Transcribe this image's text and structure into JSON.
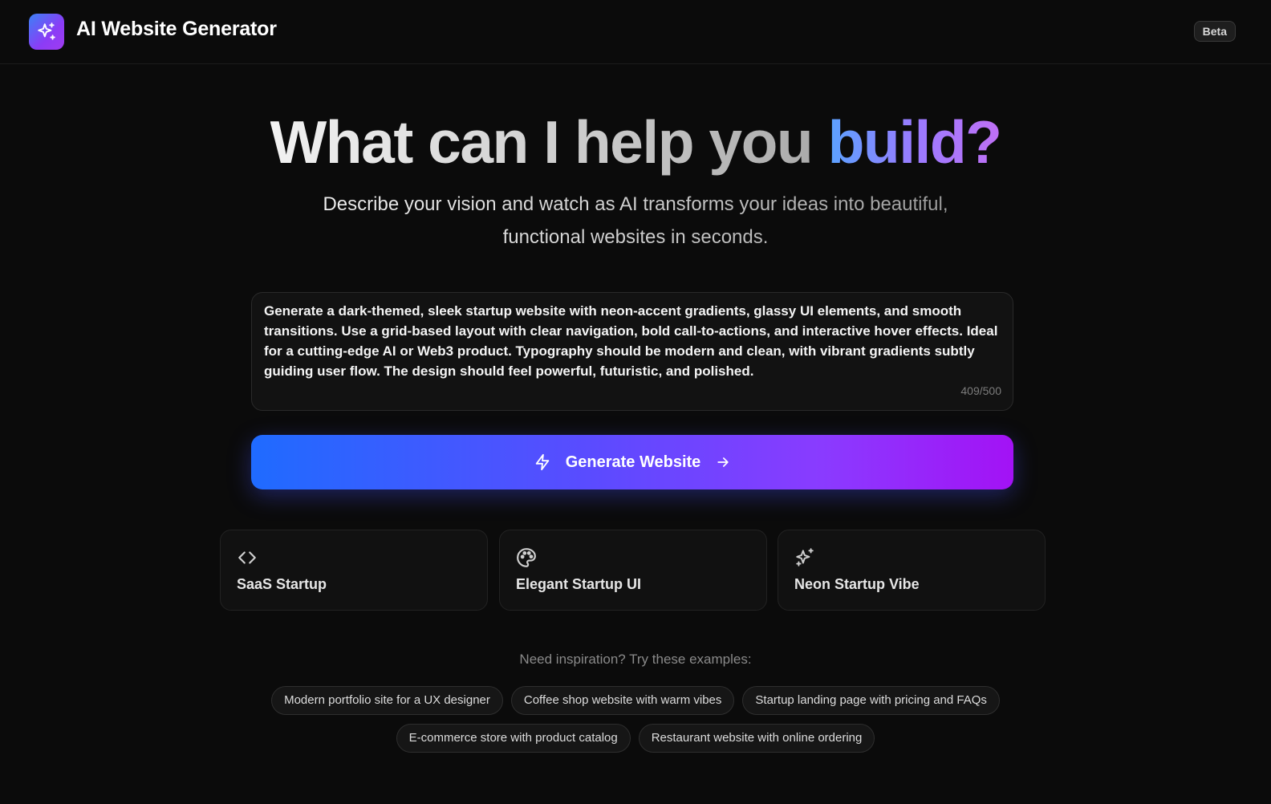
{
  "header": {
    "app_title": "AI Website Generator",
    "badge": "Beta",
    "logo_icon": "sparkles-icon"
  },
  "hero": {
    "title_plain": "What can I help you ",
    "title_accent": "build?",
    "subtitle": "Describe your vision and watch as AI transforms your ideas into beautiful, functional websites in seconds."
  },
  "prompt": {
    "value": "Generate a dark-themed, sleek startup website with neon-accent gradients, glassy UI elements, and smooth transitions. Use a grid-based layout with clear navigation, bold call-to-actions, and interactive hover effects. Ideal for a cutting-edge AI or Web3 product. Typography should be modern and clean, with vibrant gradients subtly guiding user flow. The design should feel powerful, futuristic, and polished.",
    "char_count": "409/500"
  },
  "generate_button": {
    "label": "Generate Website",
    "left_icon": "lightning-icon",
    "right_icon": "arrow-right-icon"
  },
  "templates": [
    {
      "label": "SaaS Startup",
      "icon": "code-icon"
    },
    {
      "label": "Elegant Startup UI",
      "icon": "palette-icon"
    },
    {
      "label": "Neon Startup Vibe",
      "icon": "sparkles-icon"
    }
  ],
  "inspiration": {
    "heading": "Need inspiration? Try these examples:",
    "examples": [
      "Modern portfolio site for a UX designer",
      "Coffee shop website with warm vibes",
      "Startup landing page with pricing and FAQs",
      "E-commerce store with product catalog",
      "Restaurant website with online ordering"
    ]
  },
  "colors": {
    "background": "#0b0b0b",
    "accent_start": "#1f6bff",
    "accent_end": "#a312f5"
  }
}
